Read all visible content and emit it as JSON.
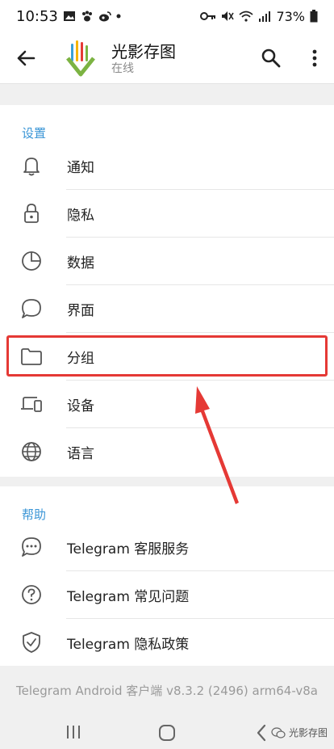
{
  "status_bar": {
    "time": "10:53",
    "battery": "73%"
  },
  "app_bar": {
    "title": "光影存图",
    "subtitle": "在线"
  },
  "settings": {
    "section_title": "设置",
    "items": [
      {
        "label": "通知",
        "icon": "bell-icon"
      },
      {
        "label": "隐私",
        "icon": "lock-icon"
      },
      {
        "label": "数据",
        "icon": "pie-chart-icon"
      },
      {
        "label": "界面",
        "icon": "chat-bubble-icon"
      },
      {
        "label": "分组",
        "icon": "folder-icon"
      },
      {
        "label": "设备",
        "icon": "devices-icon"
      },
      {
        "label": "语言",
        "icon": "globe-icon"
      }
    ]
  },
  "help": {
    "section_title": "帮助",
    "items": [
      {
        "label": "Telegram 客服服务",
        "icon": "chat-dots-icon"
      },
      {
        "label": "Telegram 常见问题",
        "icon": "question-icon"
      },
      {
        "label": "Telegram 隐私政策",
        "icon": "shield-check-icon"
      }
    ]
  },
  "footer": {
    "version": "Telegram Android 客户端 v8.3.2 (2496) arm64-v8a"
  },
  "watermark": {
    "text": "光影存图"
  },
  "colors": {
    "accent": "#3a95d6",
    "highlight": "#e53935"
  }
}
